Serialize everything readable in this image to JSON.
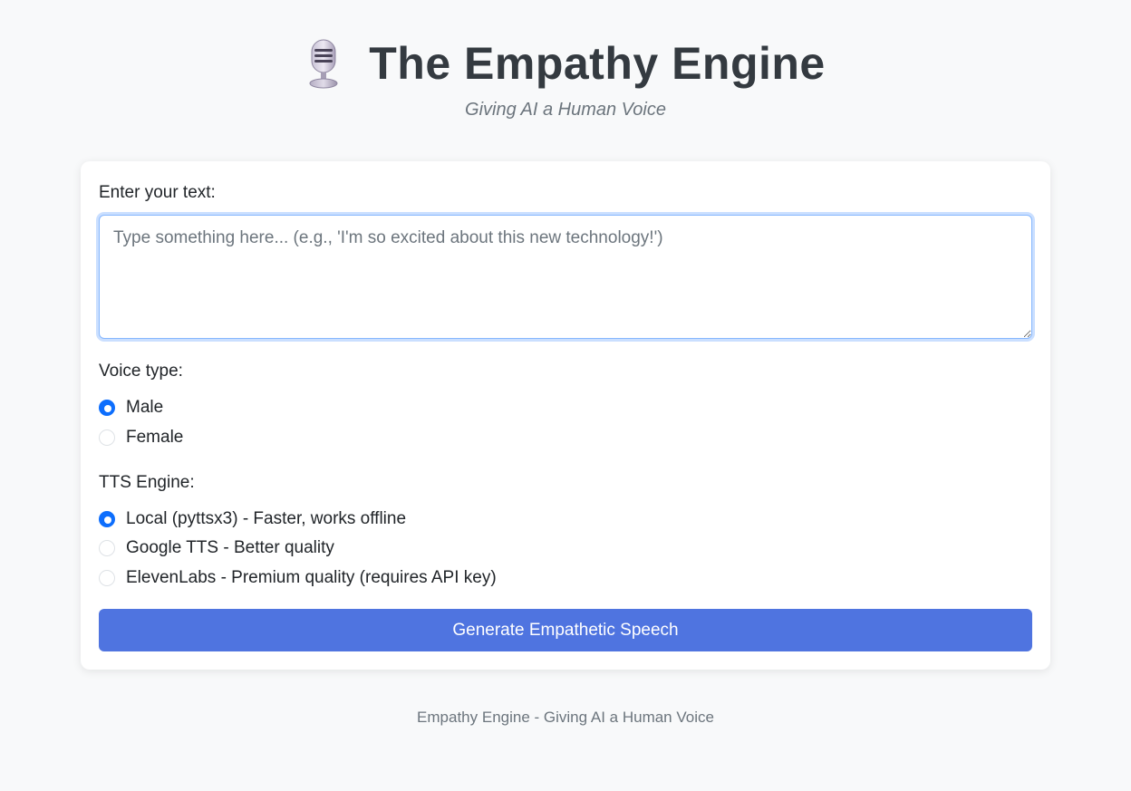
{
  "header": {
    "title": "The Empathy Engine",
    "subtitle": "Giving AI a Human Voice",
    "icon": "microphone-icon"
  },
  "form": {
    "text_label": "Enter your text:",
    "text_value": "",
    "text_placeholder": "Type something here... (e.g., 'I'm so excited about this new technology!')",
    "voice_label": "Voice type:",
    "voice_options": [
      {
        "label": "Male",
        "checked": true
      },
      {
        "label": "Female",
        "checked": false
      }
    ],
    "engine_label": "TTS Engine:",
    "engine_options": [
      {
        "label": "Local (pyttsx3) - Faster, works offline",
        "checked": true
      },
      {
        "label": "Google TTS - Better quality",
        "checked": false
      },
      {
        "label": "ElevenLabs - Premium quality (requires API key)",
        "checked": false
      }
    ],
    "submit_label": "Generate Empathetic Speech"
  },
  "footer": {
    "text": "Empathy Engine - Giving AI a Human Voice"
  },
  "colors": {
    "background": "#f8f9fa",
    "accent": "#0d6efd",
    "button": "#4f74e0",
    "muted": "#6c757d"
  }
}
